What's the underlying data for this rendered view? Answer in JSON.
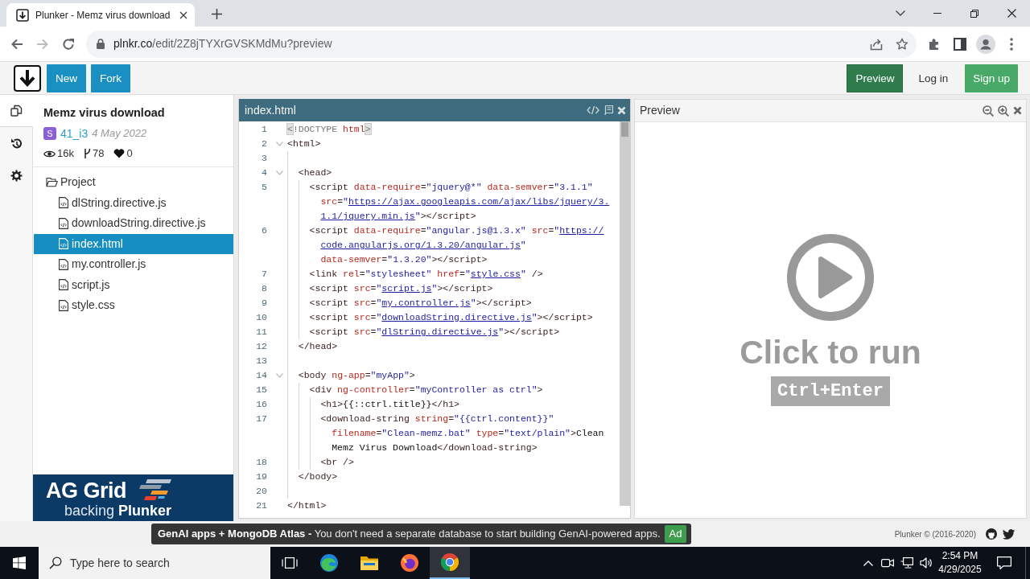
{
  "browser": {
    "tabs": [
      {
        "title": "Plunker - Memz virus download",
        "selected": true
      }
    ],
    "back": {
      "disabled": false
    },
    "forward": {
      "disabled": true
    },
    "url": {
      "host": "plnkr.co",
      "path": "/edit/2Z8jTYXrGVSKMdMu?preview"
    }
  },
  "app_bar": {
    "actions": [
      "New",
      "Fork"
    ],
    "preview_toggle": {
      "label": "Preview",
      "active": true
    },
    "login": "Log in",
    "signup": "Sign up"
  },
  "rail_tabs": [
    {
      "selected": true
    },
    {
      "selected": false
    },
    {
      "selected": false
    }
  ],
  "project": {
    "title": "Memz virus download",
    "author_initial": "S",
    "author": "41_i3",
    "date": "4 May 2022",
    "views": "16k",
    "forks": "78",
    "likes": "0"
  },
  "file_tree": {
    "label": "Project",
    "expanded": true,
    "children": [
      {
        "label": "dlString.directive.js",
        "selected": false
      },
      {
        "label": "downloadString.directive.js",
        "selected": false
      },
      {
        "label": "index.html",
        "selected": true
      },
      {
        "label": "my.controller.js",
        "selected": false
      },
      {
        "label": "script.js",
        "selected": false
      },
      {
        "label": "style.css",
        "selected": false
      }
    ]
  },
  "sponsor": {
    "name": "AG Grid",
    "tagline": "backing **Plunker**"
  },
  "editor": {
    "filename": "index.html",
    "lines": [
      {
        "number": "1",
        "foldable": false,
        "wrapped_parts": [
          {
            "tokens": [
              {
                "kind": "match",
                "text": "<"
              },
              {
                "kind": "meta",
                "text": "!DOCTYPE "
              },
              {
                "kind": "attr",
                "text": "html"
              },
              {
                "kind": "match",
                "text": ">"
              }
            ]
          }
        ]
      },
      {
        "number": "2",
        "foldable": true,
        "wrapped_parts": [
          {
            "tokens": [
              {
                "kind": "tag",
                "text": "<html>"
              }
            ]
          }
        ]
      },
      {
        "number": "3",
        "foldable": false
      },
      {
        "number": "4",
        "foldable": true,
        "wrapped_parts": [
          {
            "tokens": [
              {
                "kind": "tag",
                "text": "  <head>"
              }
            ]
          }
        ]
      },
      {
        "number": "5",
        "foldable": false,
        "wrapped_parts": [
          {
            "tokens": [
              {
                "kind": "tag",
                "text": "    <script"
              },
              {
                "kind": "attr",
                "text": " data-require"
              },
              {
                "kind": "tag",
                "text": "="
              },
              {
                "kind": "string",
                "text": "\"jquery@*\""
              },
              {
                "kind": "attr",
                "text": " data-semver"
              },
              {
                "kind": "tag",
                "text": "="
              },
              {
                "kind": "string",
                "text": "\"3.1.1\""
              }
            ]
          },
          {
            "tokens": [
              {
                "kind": "attr",
                "text": "src"
              },
              {
                "kind": "tag",
                "text": "="
              },
              {
                "kind": "string",
                "text": "\""
              },
              {
                "kind": "link",
                "text": "https://ajax.googleapis.com/ajax/libs/jquery/3."
              }
            ]
          },
          {
            "tokens": [
              {
                "kind": "link",
                "text": "1.1/jquery.min.js"
              },
              {
                "kind": "string",
                "text": "\""
              },
              {
                "kind": "tag",
                "text": "></script>"
              }
            ]
          }
        ]
      },
      {
        "number": "6",
        "foldable": false,
        "wrapped_parts": [
          {
            "tokens": [
              {
                "kind": "tag",
                "text": "    <script"
              },
              {
                "kind": "attr",
                "text": " data-require"
              },
              {
                "kind": "tag",
                "text": "="
              },
              {
                "kind": "string",
                "text": "\"angular.js@1.3.x\""
              },
              {
                "kind": "attr",
                "text": " src"
              },
              {
                "kind": "tag",
                "text": "="
              },
              {
                "kind": "string",
                "text": "\""
              },
              {
                "kind": "link",
                "text": "https://"
              }
            ]
          },
          {
            "tokens": [
              {
                "kind": "link",
                "text": "code.angularjs.org/1.3.20/angular.js"
              },
              {
                "kind": "string",
                "text": "\""
              }
            ]
          },
          {
            "tokens": [
              {
                "kind": "attr",
                "text": "data-semver"
              },
              {
                "kind": "tag",
                "text": "="
              },
              {
                "kind": "string",
                "text": "\"1.3.20\""
              },
              {
                "kind": "tag",
                "text": "></script>"
              }
            ]
          }
        ]
      },
      {
        "number": "7",
        "foldable": false,
        "wrapped_parts": [
          {
            "tokens": [
              {
                "kind": "tag",
                "text": "    <link"
              },
              {
                "kind": "attr",
                "text": " rel"
              },
              {
                "kind": "tag",
                "text": "="
              },
              {
                "kind": "string",
                "text": "\"stylesheet\""
              },
              {
                "kind": "attr",
                "text": " href"
              },
              {
                "kind": "tag",
                "text": "="
              },
              {
                "kind": "string",
                "text": "\""
              },
              {
                "kind": "link",
                "text": "style.css"
              },
              {
                "kind": "string",
                "text": "\""
              },
              {
                "kind": "tag",
                "text": " />"
              }
            ]
          }
        ]
      },
      {
        "number": "8",
        "foldable": false,
        "wrapped_parts": [
          {
            "tokens": [
              {
                "kind": "tag",
                "text": "    <script"
              },
              {
                "kind": "attr",
                "text": " src"
              },
              {
                "kind": "tag",
                "text": "="
              },
              {
                "kind": "string",
                "text": "\""
              },
              {
                "kind": "link",
                "text": "script.js"
              },
              {
                "kind": "string",
                "text": "\""
              },
              {
                "kind": "tag",
                "text": "></script>"
              }
            ]
          }
        ]
      },
      {
        "number": "9",
        "foldable": false,
        "wrapped_parts": [
          {
            "tokens": [
              {
                "kind": "tag",
                "text": "    <script"
              },
              {
                "kind": "attr",
                "text": " src"
              },
              {
                "kind": "tag",
                "text": "="
              },
              {
                "kind": "string",
                "text": "\""
              },
              {
                "kind": "link",
                "text": "my.controller.js"
              },
              {
                "kind": "string",
                "text": "\""
              },
              {
                "kind": "tag",
                "text": "></script>"
              }
            ]
          }
        ]
      },
      {
        "number": "10",
        "foldable": false,
        "wrapped_parts": [
          {
            "tokens": [
              {
                "kind": "tag",
                "text": "    <script"
              },
              {
                "kind": "attr",
                "text": " src"
              },
              {
                "kind": "tag",
                "text": "="
              },
              {
                "kind": "string",
                "text": "\""
              },
              {
                "kind": "link",
                "text": "downloadString.directive.js"
              },
              {
                "kind": "string",
                "text": "\""
              },
              {
                "kind": "tag",
                "text": "></script>"
              }
            ]
          }
        ]
      },
      {
        "number": "11",
        "foldable": false,
        "wrapped_parts": [
          {
            "tokens": [
              {
                "kind": "tag",
                "text": "    <script"
              },
              {
                "kind": "attr",
                "text": " src"
              },
              {
                "kind": "tag",
                "text": "="
              },
              {
                "kind": "string",
                "text": "\""
              },
              {
                "kind": "link",
                "text": "dlString.directive.js"
              },
              {
                "kind": "string",
                "text": "\""
              },
              {
                "kind": "tag",
                "text": "></script>"
              }
            ]
          }
        ]
      },
      {
        "number": "12",
        "foldable": false,
        "wrapped_parts": [
          {
            "tokens": [
              {
                "kind": "tag",
                "text": "  </head>"
              }
            ]
          }
        ]
      },
      {
        "number": "13",
        "foldable": false
      },
      {
        "number": "14",
        "foldable": true,
        "wrapped_parts": [
          {
            "tokens": [
              {
                "kind": "tag",
                "text": "  <body"
              },
              {
                "kind": "attr",
                "text": " ng-app"
              },
              {
                "kind": "tag",
                "text": "="
              },
              {
                "kind": "string",
                "text": "\"myApp\""
              },
              {
                "kind": "tag",
                "text": ">"
              }
            ]
          }
        ]
      },
      {
        "number": "15",
        "foldable": false,
        "wrapped_parts": [
          {
            "tokens": [
              {
                "kind": "tag",
                "text": "    <div"
              },
              {
                "kind": "attr",
                "text": " ng-controller"
              },
              {
                "kind": "tag",
                "text": "="
              },
              {
                "kind": "string",
                "text": "\"myController as ctrl\""
              },
              {
                "kind": "tag",
                "text": ">"
              }
            ]
          }
        ]
      },
      {
        "number": "16",
        "foldable": false,
        "wrapped_parts": [
          {
            "tokens": [
              {
                "kind": "tag",
                "text": "      <h1>"
              },
              {
                "kind": "text",
                "text": "{{::ctrl.title}}"
              },
              {
                "kind": "tag",
                "text": "</h1>"
              }
            ]
          }
        ]
      },
      {
        "number": "17",
        "foldable": false,
        "wrapped_parts": [
          {
            "tokens": [
              {
                "kind": "tag",
                "text": "      <download-string"
              },
              {
                "kind": "attr",
                "text": " string"
              },
              {
                "kind": "tag",
                "text": "="
              },
              {
                "kind": "string",
                "text": "\"{{ctrl.content}}\""
              }
            ]
          },
          {
            "tokens": [
              {
                "kind": "attr",
                "text": "filename"
              },
              {
                "kind": "tag",
                "text": "="
              },
              {
                "kind": "string",
                "text": "\"Clean-memz.bat\""
              },
              {
                "kind": "attr",
                "text": " type"
              },
              {
                "kind": "tag",
                "text": "="
              },
              {
                "kind": "string",
                "text": "\"text/plain\""
              },
              {
                "kind": "tag",
                "text": ">"
              },
              {
                "kind": "text",
                "text": "Clean"
              }
            ]
          },
          {
            "tokens": [
              {
                "kind": "text",
                "text": "Memz Virus Download"
              },
              {
                "kind": "tag",
                "text": "</download-string>"
              }
            ]
          }
        ]
      },
      {
        "number": "18",
        "foldable": false,
        "wrapped_parts": [
          {
            "tokens": [
              {
                "kind": "tag",
                "text": "      <br />"
              }
            ]
          }
        ]
      },
      {
        "number": "19",
        "foldable": false,
        "wrapped_parts": [
          {
            "tokens": [
              {
                "kind": "tag",
                "text": "  </body>"
              }
            ]
          }
        ]
      },
      {
        "number": "20",
        "foldable": false
      },
      {
        "number": "21",
        "foldable": false,
        "wrapped_parts": [
          {
            "tokens": [
              {
                "kind": "tag",
                "text": "</html>"
              }
            ]
          }
        ]
      }
    ]
  },
  "preview": {
    "title": "Preview",
    "prompt": "Click to run",
    "shortcut": "Ctrl+Enter"
  },
  "footer": {
    "ad": {
      "text": "**GenAI apps + MongoDB Atlas -** You don't need a separate database to start building GenAI-powered apps.",
      "badge": "Ad"
    },
    "copyright": "Plunker © (2016-2020)"
  },
  "taskbar": {
    "search": {
      "placeholder": "Type here to search"
    },
    "apps": [
      {
        "selected": false
      },
      {
        "selected": false
      },
      {
        "selected": false
      },
      {
        "selected": true
      }
    ],
    "time": "2:54 PM",
    "date": "4/29/2025"
  }
}
